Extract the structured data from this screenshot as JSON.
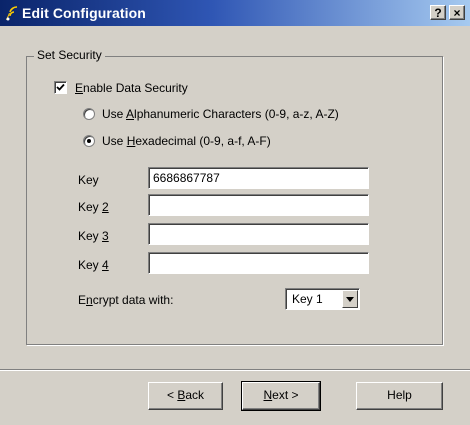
{
  "window": {
    "title": "Edit Configuration",
    "help_button": "?",
    "close_button": "×",
    "title_icon": "wireless-signal-icon",
    "title_gradient_start": "#0a246a",
    "title_gradient_end": "#a6caf0"
  },
  "security": {
    "group_label": "Set Security",
    "enable": {
      "pre": "",
      "mnemonic": "E",
      "post": "nable Data Security",
      "checked": true
    },
    "radio_alphanumeric": {
      "pre": "Use ",
      "mnemonic": "A",
      "post": "lphanumeric Characters (0-9, a-z, A-Z)",
      "selected": false
    },
    "radio_hexadecimal": {
      "pre": "Use ",
      "mnemonic": "H",
      "post": "exadecimal (0-9, a-f, A-F)",
      "selected": true
    },
    "keys": [
      {
        "label_pre": "Key",
        "mnemonic": "",
        "value": "6686867787"
      },
      {
        "label_pre": "Key ",
        "mnemonic": "2",
        "value": ""
      },
      {
        "label_pre": "Key ",
        "mnemonic": "3",
        "value": ""
      },
      {
        "label_pre": "Key ",
        "mnemonic": "4",
        "value": ""
      }
    ],
    "encrypt": {
      "pre": "E",
      "mnemonic": "n",
      "post": "crypt data with:",
      "selected": "Key 1"
    }
  },
  "buttons": {
    "back": {
      "pre": "< ",
      "mnemonic": "B",
      "post": "ack"
    },
    "next": {
      "pre": "",
      "mnemonic": "N",
      "post": "ext >"
    },
    "help": "Help"
  }
}
